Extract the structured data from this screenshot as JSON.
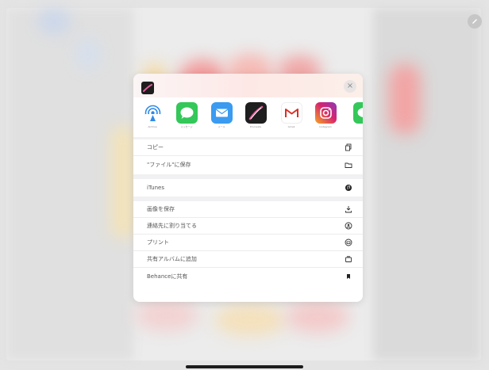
{
  "share_sheet": {
    "close_symbol": "×",
    "apps": [
      {
        "name": "AirDrop",
        "label": "AirDrop",
        "icon": "airdrop-icon",
        "color": "#2f8be8"
      },
      {
        "name": "Messages",
        "label": "メッセージ",
        "icon": "messages-icon",
        "color": "#34c759"
      },
      {
        "name": "Mail",
        "label": "メール",
        "icon": "mail-icon",
        "color": "#3a9bf0"
      },
      {
        "name": "Procreate",
        "label": "Procreate",
        "icon": "procreate-icon",
        "color": "#1e1e1e"
      },
      {
        "name": "Gmail",
        "label": "Gmail",
        "icon": "gmail-icon",
        "color": "#ffffff"
      },
      {
        "name": "Instagram",
        "label": "Instagram",
        "icon": "instagram-icon",
        "color": "#d6246e"
      },
      {
        "name": "Line",
        "label": "",
        "icon": "line-icon",
        "color": "#34c759"
      }
    ],
    "group1": [
      {
        "label": "コピー",
        "icon": "copy-icon"
      },
      {
        "label": "\"ファイル\"に保存",
        "icon": "folder-icon"
      }
    ],
    "group2": [
      {
        "label": "iTunes",
        "icon": "itunes-icon"
      }
    ],
    "group3": [
      {
        "label": "画像を保存",
        "icon": "save-image-icon"
      },
      {
        "label": "連絡先に割り当てる",
        "icon": "contact-icon"
      },
      {
        "label": "プリント",
        "icon": "print-icon"
      },
      {
        "label": "共有アルバムに追加",
        "icon": "shared-album-icon"
      },
      {
        "label": "Behanceに共有",
        "icon": "behance-icon"
      }
    ]
  }
}
